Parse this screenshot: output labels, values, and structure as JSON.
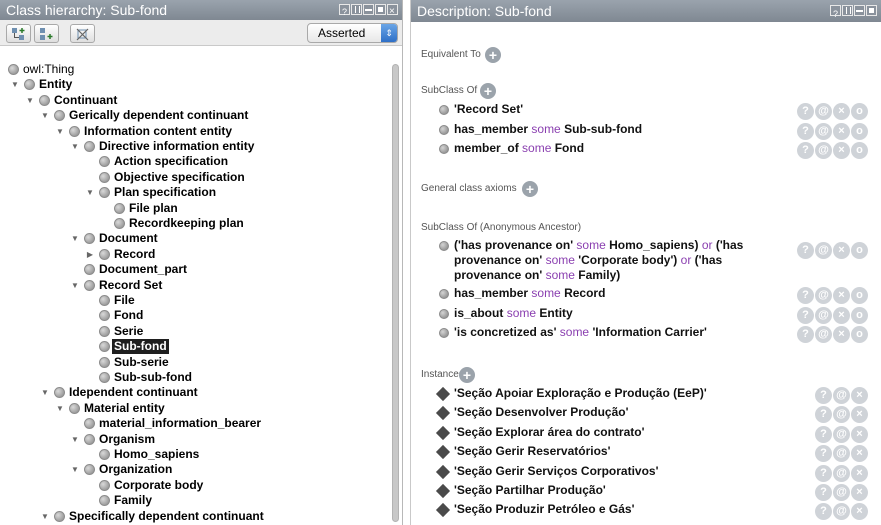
{
  "left": {
    "title": "Class hierarchy: Sub-fond",
    "select_value": "Asserted",
    "tree": [
      {
        "label": "owl:Thing"
      },
      {
        "label": "Entity"
      },
      {
        "label": "Continuant"
      },
      {
        "label": "Gerically dependent continuant"
      },
      {
        "label": "Information content entity"
      },
      {
        "label": "Directive information entity"
      },
      {
        "label": "Action specification"
      },
      {
        "label": "Objective specification"
      },
      {
        "label": "Plan specification"
      },
      {
        "label": "File plan"
      },
      {
        "label": "Recordkeeping plan"
      },
      {
        "label": "Document"
      },
      {
        "label": "Record"
      },
      {
        "label": "Document_part"
      },
      {
        "label": "Record Set"
      },
      {
        "label": "File"
      },
      {
        "label": "Fond"
      },
      {
        "label": "Serie"
      },
      {
        "label": "Sub-fond"
      },
      {
        "label": "Sub-serie"
      },
      {
        "label": "Sub-sub-fond"
      },
      {
        "label": "Idependent continuant"
      },
      {
        "label": "Material entity"
      },
      {
        "label": "material_information_bearer"
      },
      {
        "label": "Organism"
      },
      {
        "label": "Homo_sapiens"
      },
      {
        "label": "Organization"
      },
      {
        "label": "Corporate body"
      },
      {
        "label": "Family"
      },
      {
        "label": "Specifically dependent continuant"
      }
    ]
  },
  "right": {
    "title": "Description: Sub-fond",
    "sections": {
      "equivalent": "Equivalent To",
      "subclass": "SubClass Of",
      "general": "General class axioms",
      "ancestor": "SubClass Of (Anonymous Ancestor)",
      "instances": "Instances"
    },
    "subclass_axioms": [
      {
        "a": "'Record Set'"
      },
      {
        "a": "has_member",
        "kw": "some",
        "b": "Sub-sub-fond"
      },
      {
        "a": "member_of",
        "kw": "some",
        "b": "Fond"
      }
    ],
    "ancestor_multi": {
      "l1a": "('has provenance on'",
      "l1kw": "some",
      "l1b": "Homo_sapiens)",
      "l1kw2": "or",
      "l1c": "('has",
      "l2a": "provenance on'",
      "l2kw": "some",
      "l2b": "'Corporate body')",
      "l2kw2": "or",
      "l2c": "('has",
      "l3a": "provenance on'",
      "l3kw": "some",
      "l3b": "Family)"
    },
    "ancestor_axioms": [
      {
        "a": "has_member",
        "kw": "some",
        "b": "Record"
      },
      {
        "a": "is_about",
        "kw": "some",
        "b": "Entity"
      },
      {
        "a": "'is concretized as'",
        "kw": "some",
        "b": "'Information Carrier'"
      }
    ],
    "instances": [
      "'Seção Apoiar Exploração e Produção (EeP)'",
      "'Seção Desenvolver Produção'",
      "'Seção Explorar área do contrato'",
      "'Seção Gerir Reservatórios'",
      "'Seção Gerir Serviços Corporativos'",
      "'Seção Partilhar Produção'",
      "'Seção Produzir Petróleo e Gás'"
    ],
    "row_icons": {
      "help": "?",
      "annotate": "@",
      "delete": "×",
      "edit": "o"
    }
  }
}
